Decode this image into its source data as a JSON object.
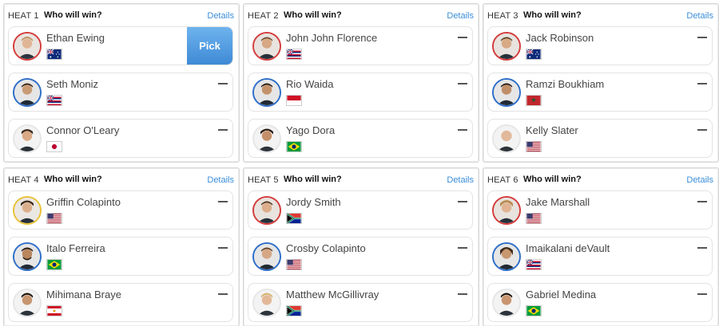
{
  "heats": [
    {
      "label": "HEAT 1",
      "question": "Who will win?",
      "details": "Details",
      "surfers": [
        {
          "name": "Ethan Ewing",
          "flag": "au",
          "ring": "red",
          "action": "Pick"
        },
        {
          "name": "Seth Moniz",
          "flag": "hi",
          "ring": "blue",
          "action": "—"
        },
        {
          "name": "Connor O'Leary",
          "flag": "jp",
          "ring": "none",
          "action": "—"
        }
      ]
    },
    {
      "label": "HEAT 2",
      "question": "Who will win?",
      "details": "Details",
      "surfers": [
        {
          "name": "John John Florence",
          "flag": "hi",
          "ring": "red",
          "action": "—"
        },
        {
          "name": "Rio Waida",
          "flag": "id",
          "ring": "blue",
          "action": "—"
        },
        {
          "name": "Yago Dora",
          "flag": "br",
          "ring": "none",
          "action": "—"
        }
      ]
    },
    {
      "label": "HEAT 3",
      "question": "Who will win?",
      "details": "Details",
      "surfers": [
        {
          "name": "Jack Robinson",
          "flag": "au",
          "ring": "red",
          "action": "—"
        },
        {
          "name": "Ramzi Boukhiam",
          "flag": "ma",
          "ring": "blue",
          "action": "—"
        },
        {
          "name": "Kelly Slater",
          "flag": "us",
          "ring": "none",
          "action": "—"
        }
      ]
    },
    {
      "label": "HEAT 4",
      "question": "Who will win?",
      "details": "Details",
      "surfers": [
        {
          "name": "Griffin Colapinto",
          "flag": "us",
          "ring": "yellow",
          "action": "—"
        },
        {
          "name": "Italo Ferreira",
          "flag": "br",
          "ring": "blue",
          "action": "—"
        },
        {
          "name": "Mihimana Braye",
          "flag": "pf",
          "ring": "none",
          "action": "—"
        }
      ]
    },
    {
      "label": "HEAT 5",
      "question": "Who will win?",
      "details": "Details",
      "surfers": [
        {
          "name": "Jordy Smith",
          "flag": "za",
          "ring": "red",
          "action": "—"
        },
        {
          "name": "Crosby Colapinto",
          "flag": "us",
          "ring": "blue",
          "action": "—"
        },
        {
          "name": "Matthew McGillivray",
          "flag": "za",
          "ring": "none",
          "action": "—"
        }
      ]
    },
    {
      "label": "HEAT 6",
      "question": "Who will win?",
      "details": "Details",
      "surfers": [
        {
          "name": "Jake Marshall",
          "flag": "us",
          "ring": "red",
          "action": "—"
        },
        {
          "name": "Imaikalani deVault",
          "flag": "hi",
          "ring": "blue",
          "action": "—"
        },
        {
          "name": "Gabriel Medina",
          "flag": "br",
          "ring": "none",
          "action": "—"
        }
      ]
    }
  ]
}
